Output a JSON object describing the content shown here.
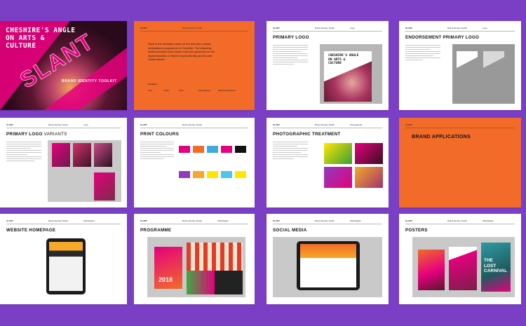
{
  "cover": {
    "title_line1": "CHESHIRE'S ANGLE",
    "title_line2": "ON ARTS &",
    "title_line3": "CULTURE",
    "logo": "SLANT",
    "subtitle": "BRAND IDENTITY TOOLKIT"
  },
  "header": {
    "brand": "SLANT",
    "doc": "Brand Identity Toolkit",
    "section_logo": "Logo",
    "section_photo": "Photographic",
    "section_web": "Web/Digital"
  },
  "intro": {
    "body": "Slant is the umbrella name for the arts and cultural destinations programme in Cheshire. The following toolkit provides some basic rules and guidance on the implementation of Slant's brand identity and its core visual assets.",
    "contents_label": "Contents",
    "cols": [
      "Intro",
      "Colour",
      "Type",
      "Photography",
      "Brand Applications"
    ]
  },
  "pages": {
    "primary_logo": "PRIMARY LOGO",
    "endorsement": "ENDORSEMENT PRIMARY LOGO",
    "logo_variants_bold": "PRIMARY LOGO",
    "logo_variants_thin": "VARIANTS",
    "print_colours": "PRINT COLOURS",
    "photo_treatment": "PHOTOGRAPHIC TREATMENT",
    "brand_applications": "BRAND APPLICATIONS",
    "website": "WEBSITE HOMEPAGE",
    "programme": "PROGRAMME",
    "social": "SOCIAL MEDIA",
    "posters": "POSTERS"
  },
  "logo_panel": {
    "line1": "CHESHIRE'S ANGLE",
    "line2": "ON ARTS &",
    "line3": "CULTURE"
  },
  "poster_text": {
    "lost_carnival_1": "THE",
    "lost_carnival_2": "LOST",
    "lost_carnival_3": "CARNIVAL",
    "programme_year": "2018"
  },
  "colors": {
    "background": "#7b3fc6",
    "magenta": "#e5007d",
    "orange": "#f26b29",
    "swatches_row1": [
      "#e5007d",
      "#f26b29",
      "#3fa9e0",
      "#e5007d",
      "#111111"
    ],
    "swatches_row2": [
      "#8e3bbf",
      "#f7a829",
      "#ffe600",
      "#4dc6e8",
      "#ffe600"
    ]
  }
}
